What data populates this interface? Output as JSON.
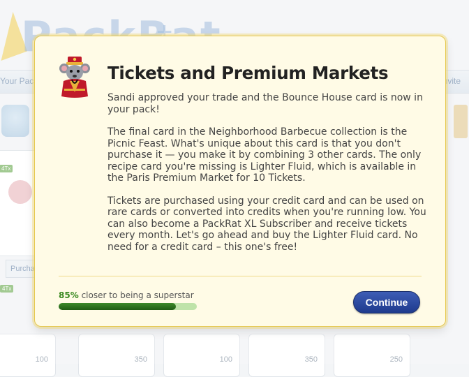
{
  "background": {
    "logo_text": "PackRat",
    "nav_left": "Your Pack",
    "nav_right": "Invite",
    "tag_label": "4Tx",
    "purchase_label": "Purcha",
    "card_counts": [
      "100",
      "350",
      "100",
      "350",
      "250"
    ]
  },
  "dialog": {
    "title": "Tickets and Premium Markets",
    "paragraphs": [
      "Sandi approved your trade and the Bounce House card is now in your pack!",
      "The final card in the Neighborhood Barbecue collection is the Picnic Feast. What's unique about this card is that you don't purchase it — you make it by combining 3 other cards. The only recipe card you're missing is Lighter Fluid, which is available in the Paris Premium Market for 10 Tickets.",
      "Tickets are purchased using your credit card and can be used on rare cards or converted into credits when you're running low. You can also become a PackRat XL Subscriber and receive tickets every month. Let's go ahead and buy the Lighter Fluid card. No need for a credit card – this one's free!"
    ],
    "progress": {
      "percent_label": "85%",
      "text": "closer to being a superstar",
      "value": 0.85
    },
    "continue_label": "Continue"
  },
  "colors": {
    "dialog_bg": "#fffbe6",
    "dialog_border": "#e6c84e",
    "progress_fill": "#2f7a20",
    "button": "#2a4aa0"
  },
  "icons": {
    "mascot": "rat-mascot-icon"
  }
}
